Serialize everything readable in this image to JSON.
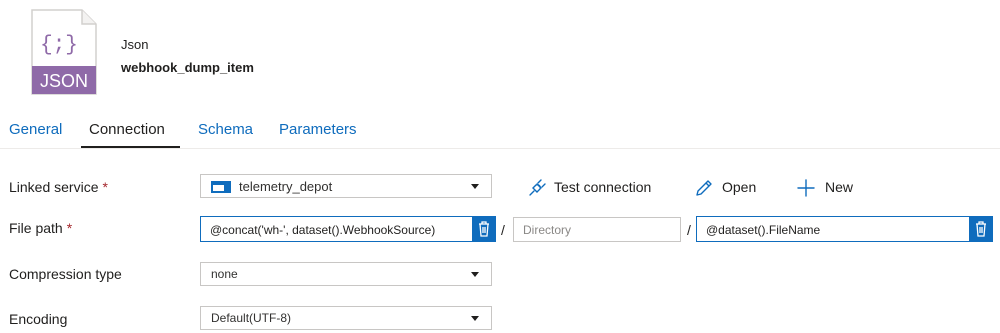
{
  "header": {
    "icon_label": "JSON",
    "icon_glyph": "{;}",
    "type": "Json",
    "name": "webhook_dump_item"
  },
  "tabs": [
    {
      "label": "General",
      "active": false
    },
    {
      "label": "Connection",
      "active": true
    },
    {
      "label": "Schema",
      "active": false
    },
    {
      "label": "Parameters",
      "active": false
    }
  ],
  "form": {
    "required_mark": "*",
    "linked_service": {
      "label": "Linked service",
      "value": "telemetry_depot"
    },
    "file_path": {
      "label": "File path",
      "container": "@concat('wh-', dataset().WebhookSource)",
      "directory_placeholder": "Directory",
      "file_name": "@dataset().FileName",
      "separator": "/"
    },
    "compression_type": {
      "label": "Compression type",
      "value": "none"
    },
    "encoding": {
      "label": "Encoding",
      "value": "Default(UTF-8)"
    }
  },
  "actions": {
    "test_connection": "Test connection",
    "open": "Open",
    "new": "New"
  },
  "colors": {
    "accent": "#0f6cbd",
    "icon_purple": "#8f6aa8",
    "required": "#a4262c"
  }
}
